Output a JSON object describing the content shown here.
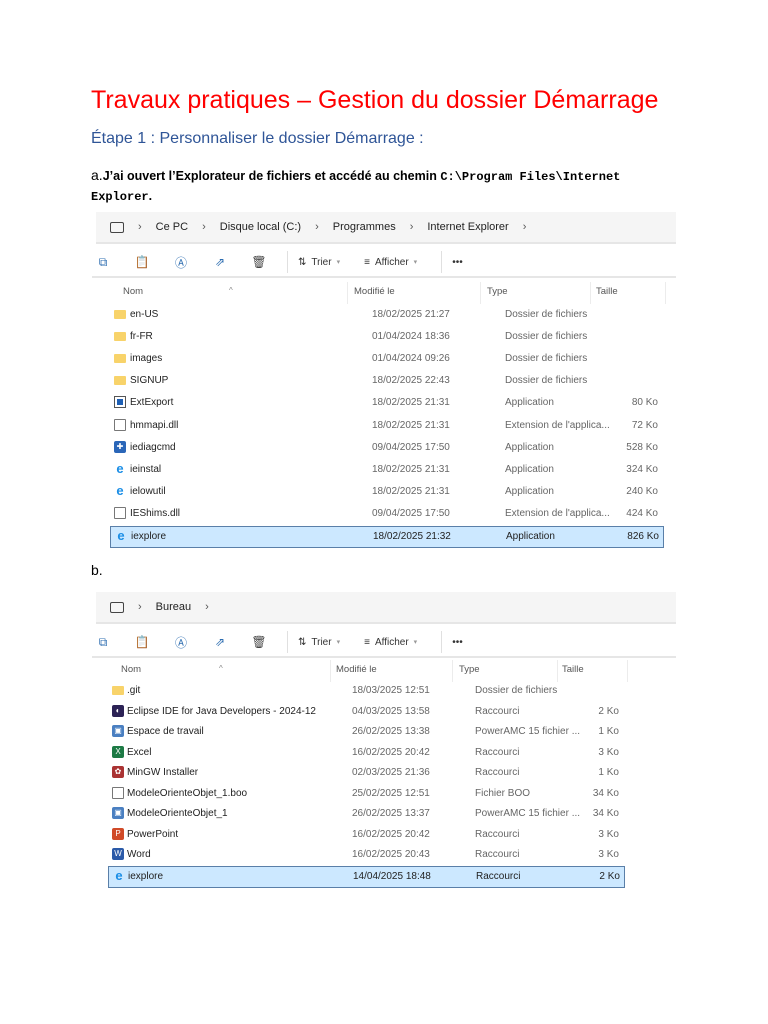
{
  "title": "Travaux pratiques – Gestion du dossier Démarrage",
  "step_heading": "Étape 1 : Personnaliser le dossier Démarrage :",
  "paragraph_a": {
    "marker": "a.",
    "text": "J’ai ouvert l’Explorateur de fichiers et accédé au chemin ",
    "path": "C:\\Program Files\\Internet Explorer",
    "end": "."
  },
  "label_b": "b.",
  "toolbar": {
    "sort_label": "Trier",
    "view_label": "Afficher",
    "more_label": "•••"
  },
  "columns": {
    "name": "Nom",
    "modified": "Modifié le",
    "type": "Type",
    "size": "Taille"
  },
  "explorer1": {
    "breadcrumb": [
      "Ce PC",
      "Disque local (C:)",
      "Programmes",
      "Internet Explorer"
    ],
    "rows": [
      {
        "icon": "folder",
        "name": "en-US",
        "modified": "18/02/2025 21:27",
        "type": "Dossier de fichiers",
        "size": ""
      },
      {
        "icon": "folder",
        "name": "fr-FR",
        "modified": "01/04/2024 18:36",
        "type": "Dossier de fichiers",
        "size": ""
      },
      {
        "icon": "folder",
        "name": "images",
        "modified": "01/04/2024 09:26",
        "type": "Dossier de fichiers",
        "size": ""
      },
      {
        "icon": "folder",
        "name": "SIGNUP",
        "modified": "18/02/2025 22:43",
        "type": "Dossier de fichiers",
        "size": ""
      },
      {
        "icon": "app",
        "name": "ExtExport",
        "modified": "18/02/2025 21:31",
        "type": "Application",
        "size": "80 Ko"
      },
      {
        "icon": "file",
        "name": "hmmapi.dll",
        "modified": "18/02/2025 21:31",
        "type": "Extension de l'applica...",
        "size": "72 Ko"
      },
      {
        "icon": "diag",
        "name": "iediagcmd",
        "modified": "09/04/2025 17:50",
        "type": "Application",
        "size": "528 Ko"
      },
      {
        "icon": "ie",
        "name": "ieinstal",
        "modified": "18/02/2025 21:31",
        "type": "Application",
        "size": "324 Ko"
      },
      {
        "icon": "ie",
        "name": "ielowutil",
        "modified": "18/02/2025 21:31",
        "type": "Application",
        "size": "240 Ko"
      },
      {
        "icon": "file",
        "name": "IEShims.dll",
        "modified": "09/04/2025 17:50",
        "type": "Extension de l'applica...",
        "size": "424 Ko"
      },
      {
        "icon": "ie",
        "name": "iexplore",
        "modified": "18/02/2025 21:32",
        "type": "Application",
        "size": "826 Ko",
        "selected": true
      }
    ]
  },
  "explorer2": {
    "breadcrumb": [
      "Bureau"
    ],
    "rows": [
      {
        "icon": "folder",
        "name": ".git",
        "modified": "18/03/2025 12:51",
        "type": "Dossier de fichiers",
        "size": ""
      },
      {
        "icon": "eclipse",
        "name": "Eclipse IDE for Java Developers - 2024-12",
        "modified": "04/03/2025 13:58",
        "type": "Raccourci",
        "size": "2 Ko"
      },
      {
        "icon": "workspace",
        "name": "Espace de travail",
        "modified": "26/02/2025 13:38",
        "type": "PowerAMC 15 fichier ...",
        "size": "1 Ko"
      },
      {
        "icon": "excel",
        "name": "Excel",
        "modified": "16/02/2025 20:42",
        "type": "Raccourci",
        "size": "3 Ko"
      },
      {
        "icon": "mingw",
        "name": "MinGW Installer",
        "modified": "02/03/2025 21:36",
        "type": "Raccourci",
        "size": "1 Ko"
      },
      {
        "icon": "file",
        "name": "ModeleOrienteObjet_1.boo",
        "modified": "25/02/2025 12:51",
        "type": "Fichier BOO",
        "size": "34 Ko"
      },
      {
        "icon": "workspace",
        "name": "ModeleOrienteObjet_1",
        "modified": "26/02/2025 13:37",
        "type": "PowerAMC 15 fichier ...",
        "size": "34 Ko"
      },
      {
        "icon": "powerpoint",
        "name": "PowerPoint",
        "modified": "16/02/2025 20:42",
        "type": "Raccourci",
        "size": "3 Ko"
      },
      {
        "icon": "word",
        "name": "Word",
        "modified": "16/02/2025 20:43",
        "type": "Raccourci",
        "size": "3 Ko"
      },
      {
        "icon": "ie",
        "name": "iexplore",
        "modified": "14/04/2025 18:48",
        "type": "Raccourci",
        "size": "2 Ko",
        "selected": true
      }
    ]
  },
  "colors": {
    "title": "#ff0000",
    "heading": "#2f5597",
    "selection": "#cce8ff"
  }
}
